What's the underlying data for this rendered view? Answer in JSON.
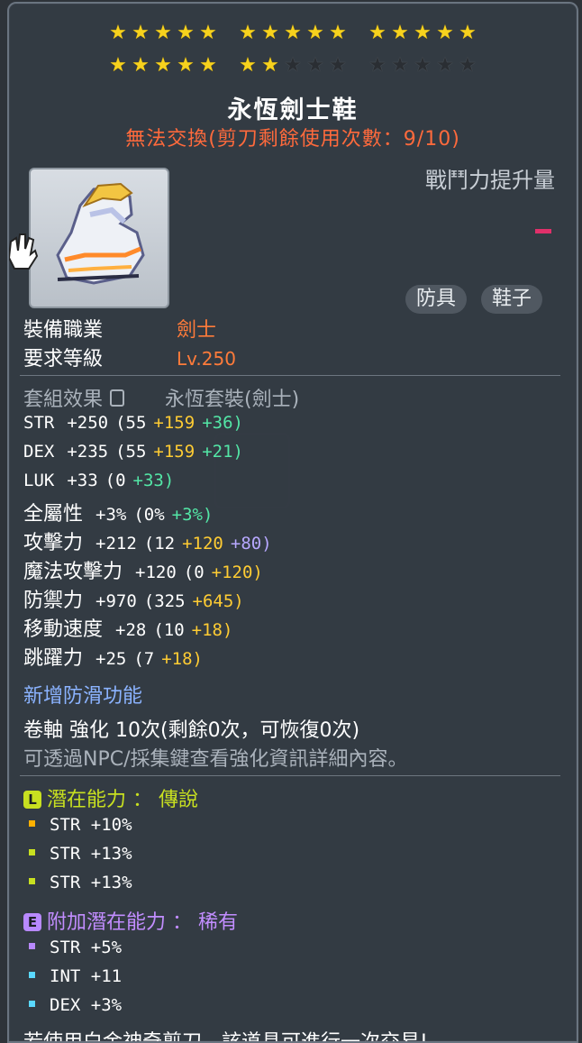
{
  "stars": {
    "row1": [
      5,
      5,
      5
    ],
    "row2": [
      5,
      2,
      0
    ],
    "per_group": 5
  },
  "item": {
    "name": "永恆劍士鞋",
    "trade_note": "無法交換(剪刀剩餘使用次數：9/10)",
    "power_label": "戰鬥力提升量",
    "tags": [
      "防具",
      "鞋子"
    ]
  },
  "requirements": {
    "job_label": "裝備職業",
    "job_value": "劍士",
    "level_label": "要求等級",
    "level_value": "Lv.250"
  },
  "set_effect": {
    "label": "套組效果",
    "value": "永恆套裝(劍士)"
  },
  "stats": [
    {
      "name": "STR",
      "total": "+250",
      "base": "(55",
      "bonus1": "+159",
      "bonus2": "+36)",
      "c2": "green"
    },
    {
      "name": "DEX",
      "total": "+235",
      "base": "(55",
      "bonus1": "+159",
      "bonus2": "+21)",
      "c2": "green"
    },
    {
      "name": "LUK",
      "total": "+33",
      "base": "(0",
      "bonus1": "+33)",
      "bonus2": "",
      "c1": "green"
    },
    {
      "name": "全屬性",
      "total": "+3%",
      "base": "(0%",
      "bonus1": "+3%)",
      "bonus2": "",
      "c1": "green"
    },
    {
      "name": "攻擊力",
      "total": "+212",
      "base": "(12",
      "bonus1": "+120",
      "bonus2": "+80)",
      "c2": "purple"
    },
    {
      "name": "魔法攻擊力",
      "total": "+120",
      "base": "(0",
      "bonus1": "+120)",
      "bonus2": ""
    },
    {
      "name": "防禦力",
      "total": "+970",
      "base": "(325",
      "bonus1": "+645)",
      "bonus2": ""
    },
    {
      "name": "移動速度",
      "total": "+28",
      "base": "(10",
      "bonus1": "+18)",
      "bonus2": ""
    },
    {
      "name": "跳躍力",
      "total": "+25",
      "base": "(7",
      "bonus1": "+18)",
      "bonus2": ""
    }
  ],
  "extra_ability": "新增防滑功能",
  "scroll": {
    "line": "卷軸 強化 10次(剩餘0次，可恢復0次)",
    "hint": "可透過NPC/採集鍵查看強化資訊詳細內容。"
  },
  "potential": {
    "icon": "L",
    "label": "潛在能力 ： 傳說",
    "lines": [
      "STR +10%",
      "STR +13%",
      "STR +13%"
    ],
    "bullet_colors": [
      "#ffb000",
      "#c8e020",
      "#c8e020"
    ]
  },
  "bonus_potential": {
    "icon": "E",
    "label": "附加潛在能力 ： 稀有",
    "lines": [
      "STR +5%",
      "INT +11",
      "DEX +3%"
    ],
    "bullet_colors": [
      "#b889ff",
      "#5ad8ff",
      "#5ad8ff"
    ]
  },
  "footer_note": "若使用白金神奇剪刀，該道具可進行一次交易!",
  "colors": {
    "title": "#ffffff",
    "trade": "#ff6a3c",
    "job": "#ff7b3a",
    "potential": "#c8e020",
    "bonus_potential": "#c28dff",
    "extra_ability": "#8bb3ff"
  }
}
